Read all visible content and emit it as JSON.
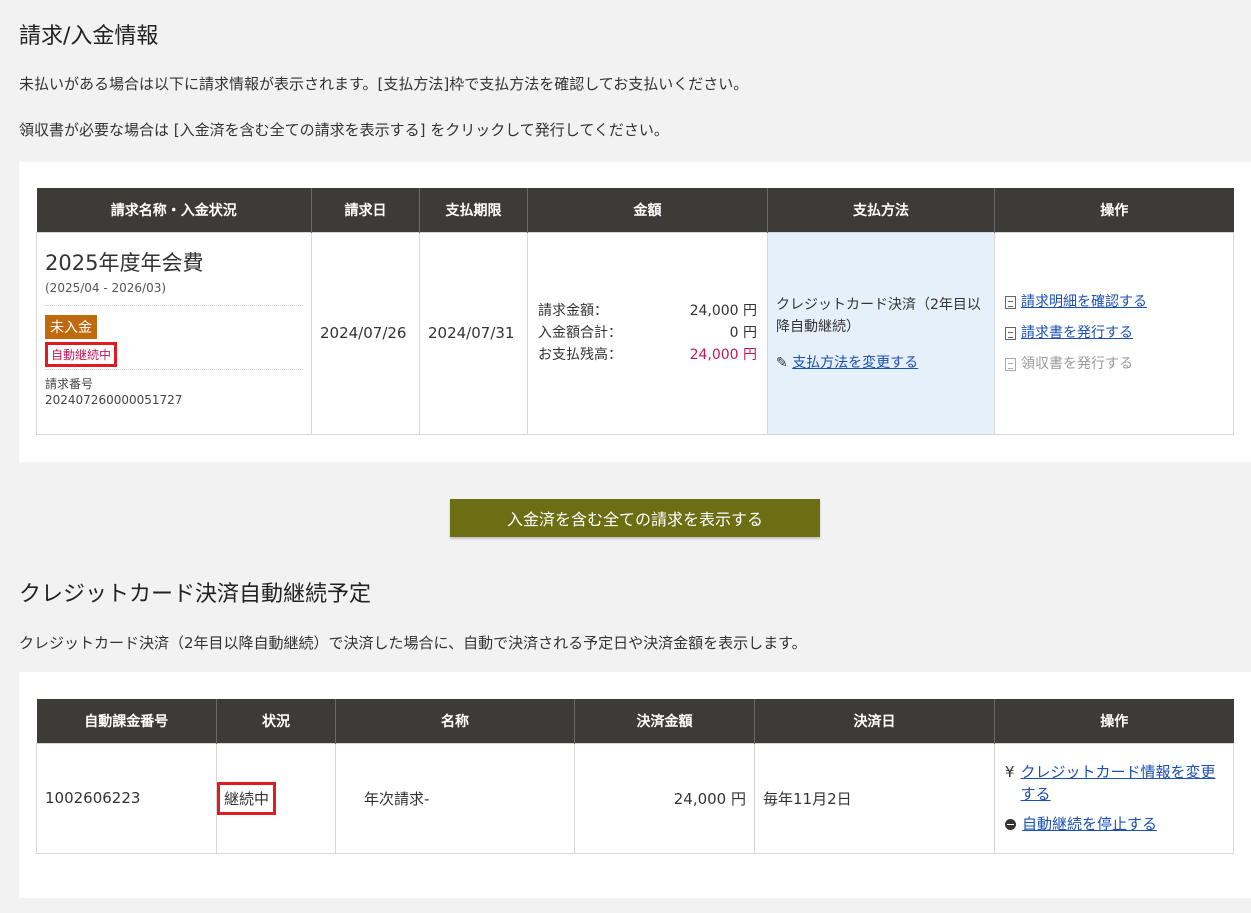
{
  "billing": {
    "title": "請求/入金情報",
    "desc1": "未払いがある場合は以下に請求情報が表示されます。[支払方法]枠で支払方法を確認してお支払いください。",
    "desc2": "領収書が必要な場合は [入金済を含む全ての請求を表示する] をクリックして発行してください。",
    "headers": [
      "請求名称・入金状況",
      "請求日",
      "支払期限",
      "金額",
      "支払方法",
      "操作"
    ],
    "row": {
      "name": "2025年度年会費",
      "period": "(2025/04 - 2026/03)",
      "unpaid_badge": "未入金",
      "auto_badge": "自動継続中",
      "bill_no_label": "請求番号",
      "bill_no": "202407260000051727",
      "bill_date": "2024/07/26",
      "due_date": "2024/07/31",
      "amount_rows": [
        {
          "label": "請求金額：",
          "value": "24,000 円"
        },
        {
          "label": "入金額合計：",
          "value": "0 円"
        },
        {
          "label": "お支払残高：",
          "value": "24,000 円"
        }
      ],
      "pay_method": "クレジットカード決済（2年目以降自動継続）",
      "change_pay_link": "支払方法を変更する",
      "ops": {
        "detail": "請求明細を確認する",
        "invoice": "請求書を発行する",
        "receipt": "領収書を発行する"
      }
    },
    "show_all_button": "入金済を含む全ての請求を表示する"
  },
  "auto": {
    "title": "クレジットカード決済自動継続予定",
    "desc": "クレジットカード決済（2年目以降自動継続）で決済した場合に、自動で決済される予定日や決済金額を表示します。",
    "headers": [
      "自動課金番号",
      "状況",
      "名称",
      "決済金額",
      "決済日",
      "操作"
    ],
    "row": {
      "number": "1002606223",
      "status": "継続中",
      "name": "年次請求‐",
      "amount": "24,000 円",
      "date": "毎年11月2日",
      "change_card": "クレジットカード情報を変更する",
      "stop_auto": "自動継続を停止する",
      "yen_icon": "¥"
    }
  },
  "colors": {
    "header_bg": "#3d3b38",
    "unpaid_badge": "#c06a10",
    "highlight_box": "#e11b22",
    "button_bg": "#6b6e12",
    "pay_cell_bg": "#e6f0fa",
    "link": "#1a4fb4"
  }
}
